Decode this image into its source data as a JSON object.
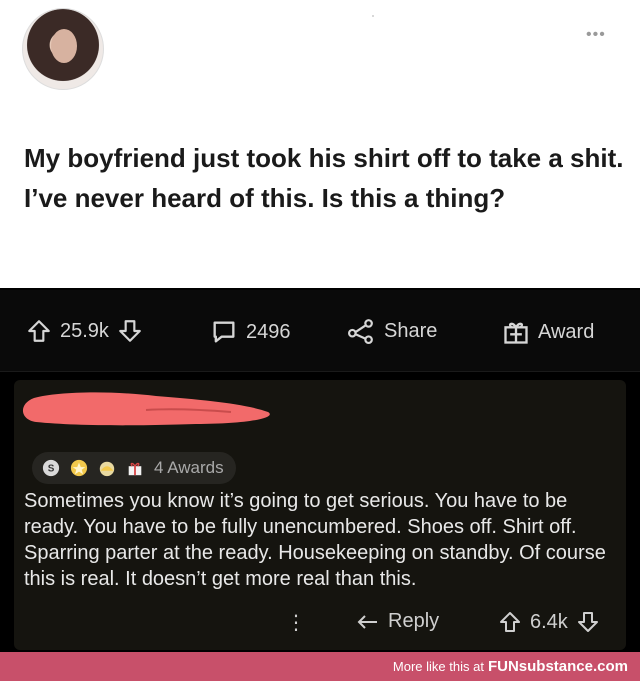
{
  "post": {
    "text": "My boyfriend just took his shirt off to take a shit. I’ve never heard of this. Is this a thing?",
    "menu": "•••"
  },
  "actions": {
    "upvotes": "25.9k",
    "comments": "2496",
    "share_label": "Share",
    "award_label": "Award"
  },
  "comment": {
    "awards_label": "4 Awards",
    "body": "Sometimes you know it’s going to get serious. You have to be ready. You have to be fully unencumbered. Shoes off. Shirt off. Sparring parter at the ready. Housekeeping on standby. Of course this is real. It doesn’t get more real than this.",
    "more": "⋮",
    "reply_label": "Reply",
    "score": "6.4k"
  },
  "footer": {
    "prefix": "More like this at",
    "brand": "FUNsubstance.com"
  },
  "colors": {
    "accent": "#c8506a",
    "redaction": "#f26a6a"
  }
}
